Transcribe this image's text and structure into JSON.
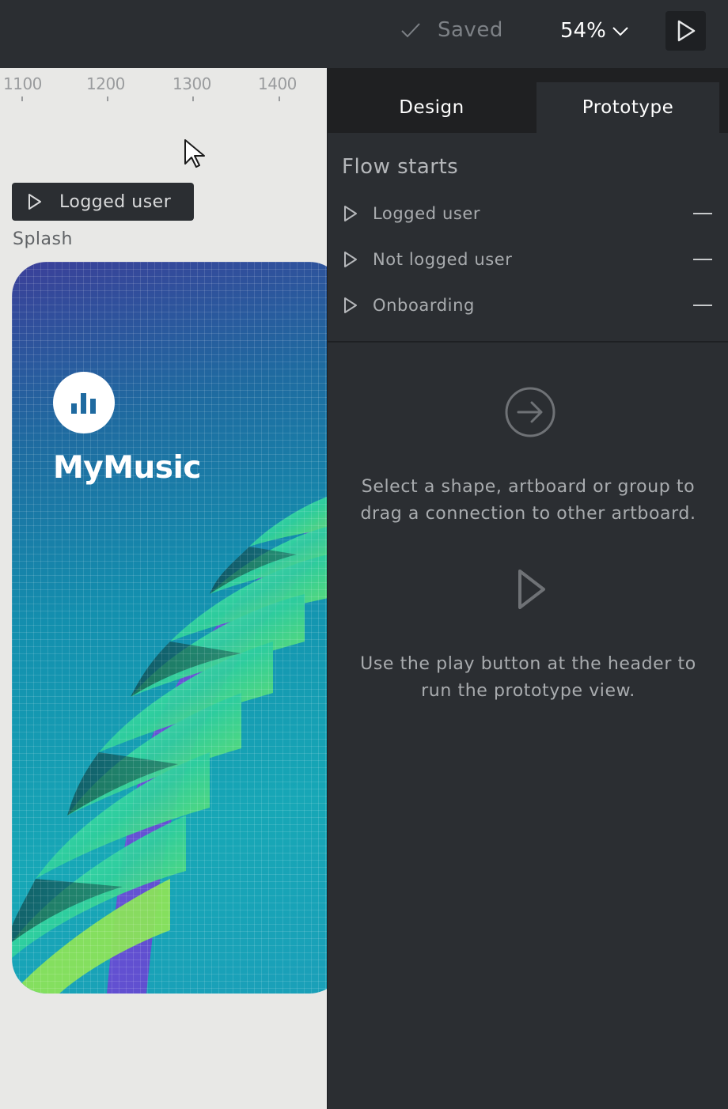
{
  "header": {
    "saved_label": "Saved",
    "zoom_label": "54%"
  },
  "canvas": {
    "ruler_labels": [
      "1100",
      "1200",
      "1300",
      "1400"
    ],
    "flow_chip_label": "Logged user",
    "artboard_name": "Splash",
    "artboard": {
      "brand_name": "MyMusic"
    }
  },
  "panel": {
    "tabs": [
      {
        "label": "Design"
      },
      {
        "label": "Prototype",
        "active": true
      }
    ],
    "section_title": "Flow starts",
    "flows": [
      {
        "label": "Logged user"
      },
      {
        "label": "Not logged user"
      },
      {
        "label": "Onboarding"
      }
    ],
    "help_connect": "Select a shape, artboard or group to drag a connection to other artboard.",
    "help_play": "Use the play button at the header to run the prototype view."
  },
  "colors": {
    "background": "#2b2e32",
    "tab_bar": "#1f2022",
    "canvas": "#e8e8e6",
    "text_muted": "#a9acaf",
    "text_primary": "#ffffff"
  },
  "icons": [
    "check-icon",
    "chevron-down-icon",
    "play-icon",
    "cursor-icon",
    "bar-chart-icon",
    "arrow-right-circle-icon"
  ]
}
